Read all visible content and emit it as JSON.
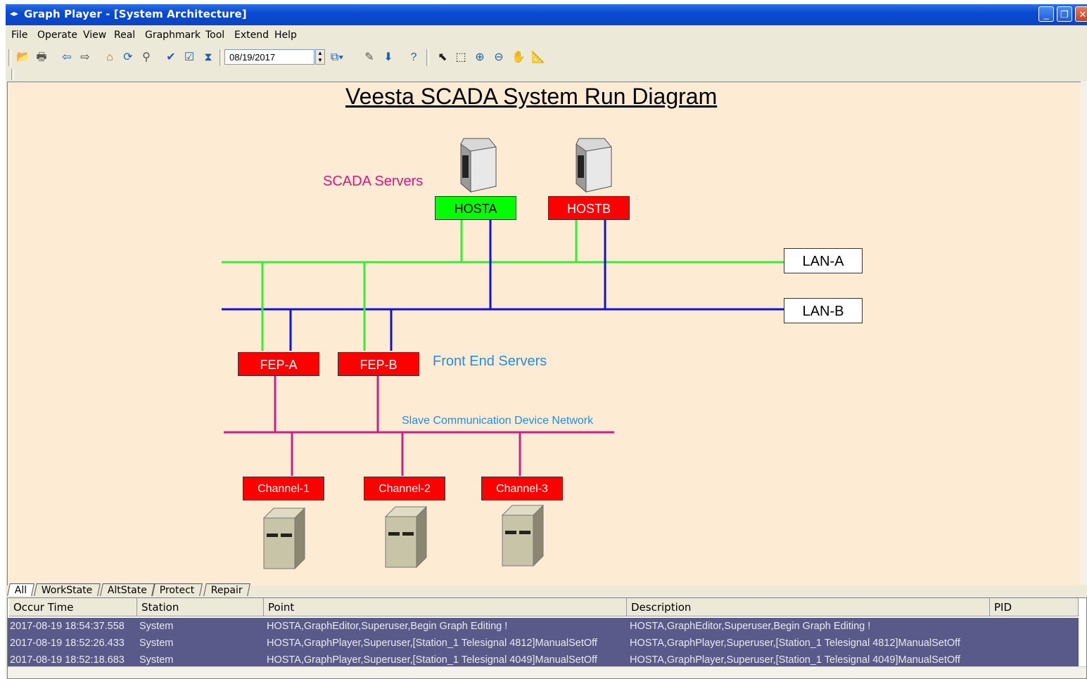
{
  "window": {
    "title": "Graph Player - [System Architecture]",
    "controls": {
      "minimize": "_",
      "restore": "❐",
      "close": "✕"
    }
  },
  "menu": [
    "File",
    "Operate",
    "View",
    "Real",
    "Graphmark",
    "Tool",
    "Extend",
    "Help"
  ],
  "toolbar": {
    "date": "08/19/2017",
    "icons": [
      "open-icon",
      "print-icon",
      "back-icon",
      "forward-icon",
      "home-icon",
      "refresh-icon",
      "search-icon",
      "ok-icon",
      "check-icon",
      "sync-icon",
      "layer-icon",
      "edit-icon",
      "download-icon",
      "help-icon",
      "pointer-icon",
      "select-icon",
      "zoom-in-icon",
      "zoom-out-icon",
      "hand-icon",
      "ruler-icon"
    ]
  },
  "diagram": {
    "title": "Veesta SCADA System Run Diagram",
    "scada_label": "SCADA Servers",
    "front_end_label": "Front End Servers",
    "slave_label": "Slave Communication Device Network",
    "hosts": [
      {
        "name": "HOSTA",
        "status": "green"
      },
      {
        "name": "HOSTB",
        "status": "red"
      }
    ],
    "lans": [
      "LAN-A",
      "LAN-B"
    ],
    "feps": [
      "FEP-A",
      "FEP-B"
    ],
    "channels": [
      "Channel-1",
      "Channel-2",
      "Channel-3"
    ],
    "colors": {
      "lan_a": "#33ee33",
      "lan_b": "#1010dd",
      "slave": "#c8208c",
      "canvas": "#fdebd3"
    }
  },
  "tabs": [
    "All",
    "WorkState",
    "AltState",
    "Protect",
    "Repair"
  ],
  "active_tab": "All",
  "events": {
    "columns": [
      "Occur Time",
      "Station",
      "Point",
      "Description",
      "PID"
    ],
    "rows": [
      [
        "2017-08-19 18:54:37.558",
        "System",
        "HOSTA,GraphEditor,Superuser,Begin Graph Editing !",
        "HOSTA,GraphEditor,Superuser,Begin Graph Editing !",
        ""
      ],
      [
        "2017-08-19 18:52:26.433",
        "System",
        "HOSTA,GraphPlayer,Superuser,[Station_1 Telesignal 4812]ManualSetOff",
        "HOSTA,GraphPlayer,Superuser,[Station_1 Telesignal 4812]ManualSetOff",
        ""
      ],
      [
        "2017-08-19 18:52:18.683",
        "System",
        "HOSTA,GraphPlayer,Superuser,[Station_1 Telesignal 4049]ManualSetOff",
        "HOSTA,GraphPlayer,Superuser,[Station_1 Telesignal 4049]ManualSetOff",
        ""
      ]
    ]
  }
}
